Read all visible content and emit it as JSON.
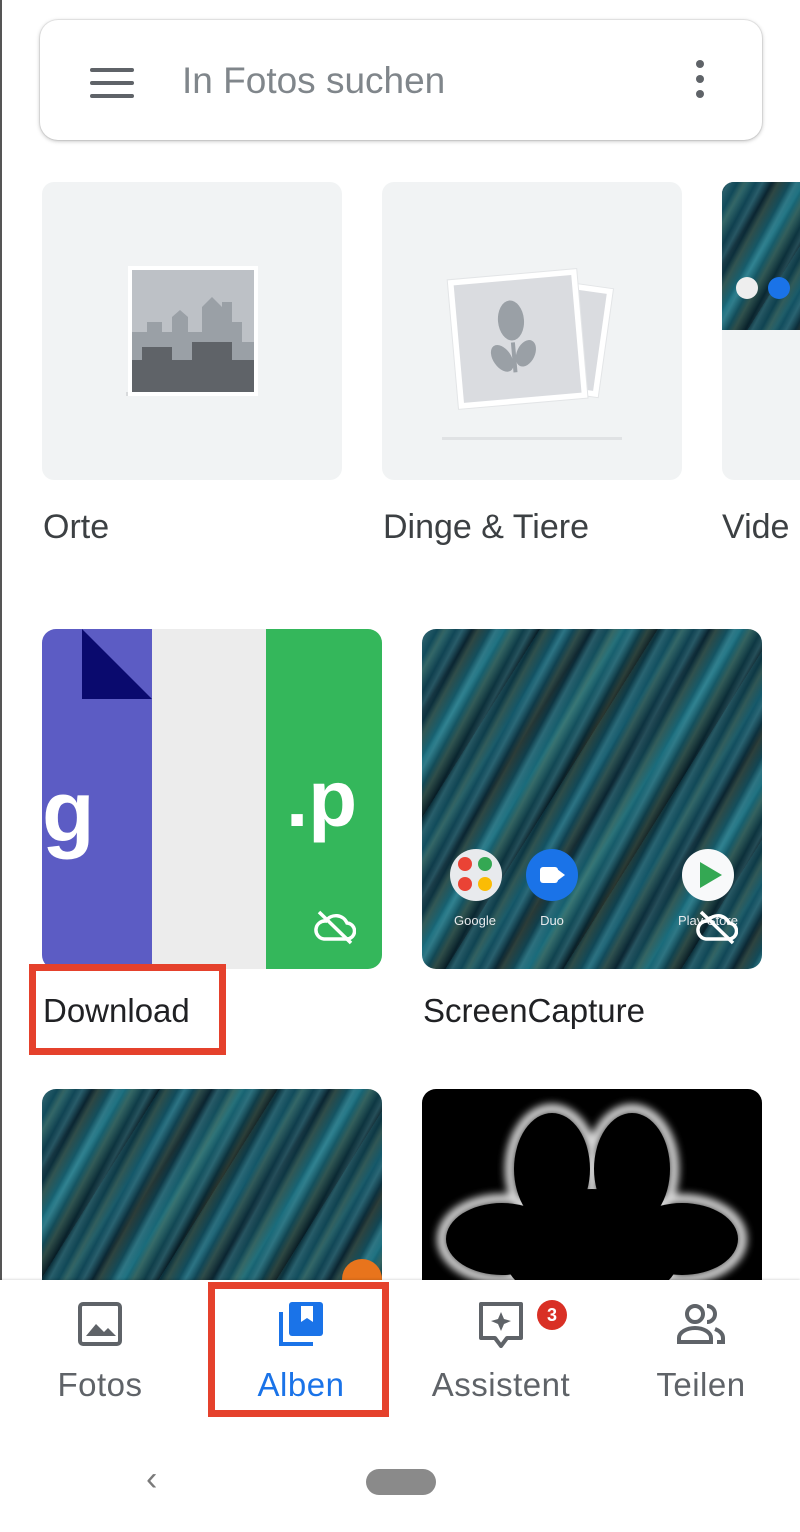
{
  "search": {
    "placeholder": "In Fotos suchen",
    "menu_icon": "menu-icon",
    "more_icon": "more-vert-icon"
  },
  "categories": [
    {
      "label": "Orte",
      "icon": "city-places-icon"
    },
    {
      "label": "Dinge & Tiere",
      "icon": "flower-photos-icon"
    },
    {
      "label": "Vide"
    }
  ],
  "albums": [
    {
      "label": "Download",
      "thumb_text_left": "g",
      "thumb_text_right": ".p",
      "status_icon": "cloud-off-icon",
      "highlighted": true
    },
    {
      "label": "ScreenCapture",
      "apps": [
        "Google",
        "Duo",
        "Play Store"
      ]
    },
    {
      "label": ""
    },
    {
      "label": ""
    }
  ],
  "bottom_nav": {
    "items": [
      {
        "label": "Fotos",
        "icon": "photo-icon",
        "active": false
      },
      {
        "label": "Alben",
        "icon": "albums-icon",
        "active": true
      },
      {
        "label": "Assistent",
        "icon": "assistant-icon",
        "badge": "3",
        "active": false
      },
      {
        "label": "Teilen",
        "icon": "people-icon",
        "active": false
      }
    ]
  },
  "colors": {
    "accent": "#1a73e8",
    "highlight": "#e5412c",
    "badge": "#d93025",
    "download_purple": "#5c5cc4",
    "download_green": "#34b75b"
  }
}
